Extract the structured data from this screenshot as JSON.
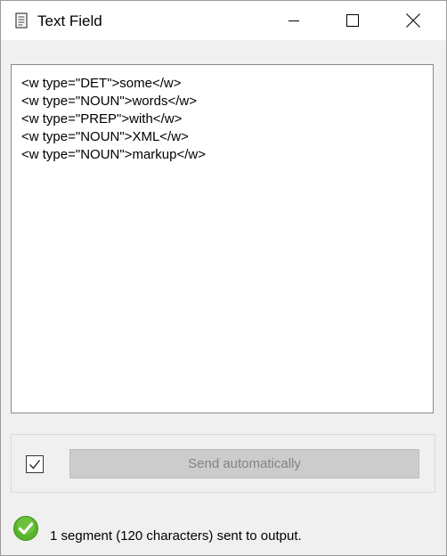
{
  "window": {
    "title": "Text Field",
    "icon": "document-icon",
    "buttons": {
      "minimize": "minimize-icon",
      "maximize": "maximize-icon",
      "close": "close-icon"
    }
  },
  "editor": {
    "content": "<w type=\"DET\">some</w>\n<w type=\"NOUN\">words</w>\n<w type=\"PREP\">with</w>\n<w type=\"NOUN\">XML</w>\n<w type=\"NOUN\">markup</w>"
  },
  "controls": {
    "auto_send_checked": true,
    "send_label": "Send automatically"
  },
  "status": {
    "icon": "success-check-icon",
    "color": "#58b42a",
    "text": "1 segment (120 characters) sent to output."
  }
}
